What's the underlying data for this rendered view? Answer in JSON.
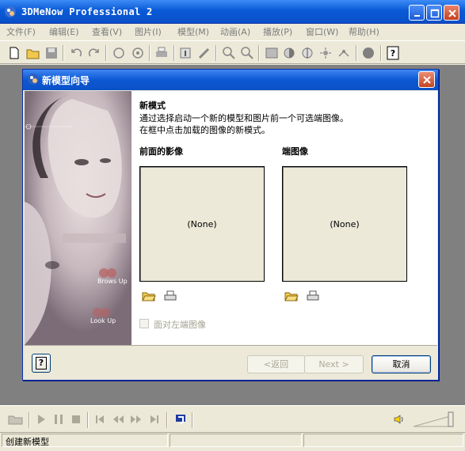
{
  "app": {
    "title": "3DMeNow Professional 2"
  },
  "menu": {
    "items": [
      "文件(F)",
      "编辑(E)",
      "查看(V)",
      "图片(I)",
      "模型(M)",
      "动画(A)",
      "播放(P)",
      "窗口(W)",
      "帮助(H)"
    ]
  },
  "toolbar": {
    "icons": [
      "new-file-icon",
      "open-folder-icon",
      "save-icon",
      "undo-icon",
      "redo-icon",
      "rotate-left-icon",
      "rotate-right-icon",
      "print-icon",
      "import-icon",
      "tool-icon",
      "zoom-in-icon",
      "zoom-out-icon",
      "image-icon",
      "half-sphere-icon",
      "mirror-icon",
      "light-icon",
      "joint-icon",
      "sphere-icon",
      "help-icon"
    ]
  },
  "dialog": {
    "title": "新模型向导",
    "intro_title": "新模式",
    "intro_lines": [
      "通过选择启动一个新的模型和图片前一个可选端图像。",
      "在框中点击加载的图像的新模式。"
    ],
    "front_label": "前面的影像",
    "side_label": "端图像",
    "front_value": "(None)",
    "side_value": "(None)",
    "checkbox_label": "面对左端图像",
    "side_image_labels": [
      "Brows Up",
      "Look Up"
    ],
    "buttons": {
      "back": "<返回",
      "next": "Next >",
      "cancel": "取消"
    }
  },
  "status": {
    "text": "创建新模型"
  }
}
